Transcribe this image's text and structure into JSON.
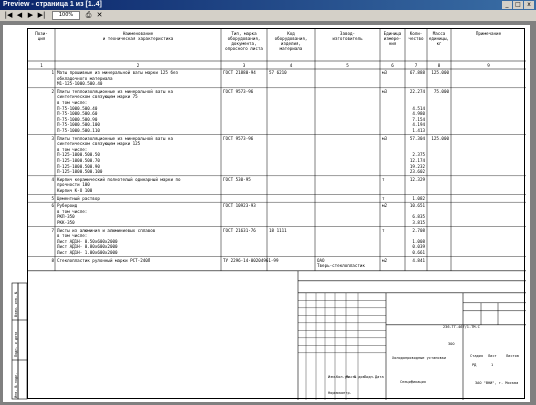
{
  "window": {
    "title": "Preview - страница 1 из [1..4]",
    "controls": [
      "_",
      "□",
      "x"
    ]
  },
  "toolbar": {
    "buttons": [
      "|◀",
      "◀",
      "▶",
      "▶|",
      "⎙",
      "✕"
    ],
    "page_select": "100%"
  },
  "spec": {
    "headers": [
      "Пози-\nция",
      "Наименование\nи техническая характеристика",
      "Тип, марка\nоборудования,\nдокумента,\nопросного листа",
      "Код\nоборудования,\nизделия,\nматериала",
      "Завод-\nизготовитель",
      "Единица\nизмере-\nния",
      "Коли-\nчество",
      "Масса\nединицы,\nкг",
      "Примечание"
    ],
    "col_numbers": [
      "1",
      "2",
      "3",
      "4",
      "5",
      "6",
      "7",
      "8",
      "9"
    ],
    "rows": [
      {
        "pos": "1",
        "name": [
          "Маты прошивные из минеральной ваты марки 125 без",
          "обкладочного материала",
          "М1-125-1000.500.40"
        ],
        "doc": "ГОСТ 21880-94",
        "code": "57 6210",
        "maker": "",
        "unit": "м3",
        "qty": [
          "67.888"
        ],
        "mass": "125.000",
        "note": ""
      },
      {
        "pos": "2",
        "name": [
          "Плиты теплоизоляционные из минеральной ваты на",
          "синтетическом связующем марки 75",
          "в том числе:",
          "П-75-1000.500.40",
          "П-75-1000.500.60",
          "П-75-1000.500.90",
          "П-75-1000.500.100",
          "П-75-1000.500.110"
        ],
        "doc": "ГОСТ 9573-96",
        "code": "",
        "maker": "",
        "unit": "м3",
        "qty": [
          "22.274",
          "",
          "",
          "4.514",
          "4.980",
          "7.154",
          "4.194",
          "1.413"
        ],
        "mass": "75.000",
        "note": ""
      },
      {
        "pos": "3",
        "name": [
          "Плиты теплоизоляционные из минеральной ваты на",
          "синтетическом связующем марки 125",
          "в том числе:",
          "П-125-1000.500.50",
          "П-125-1000.500.70",
          "П-125-1000.500.90",
          "П-125-1000.500.100"
        ],
        "doc": "ГОСТ 9573-96",
        "code": "",
        "maker": "",
        "unit": "м3",
        "qty": [
          "57.304",
          "",
          "",
          "2.375",
          "12.174",
          "19.232",
          "23.602"
        ],
        "mass": "125.000",
        "note": ""
      },
      {
        "pos": "4",
        "name": [
          "Кирпич керамический полнотелый одинарный марки по",
          "прочности 100",
          "Кирпич К-О 100"
        ],
        "doc": "ГОСТ 530-95",
        "code": "",
        "maker": "",
        "unit": "т",
        "qty": [
          "12.329"
        ],
        "mass": "",
        "note": ""
      },
      {
        "pos": "5",
        "name": [
          "Цементный раствор"
        ],
        "doc": "",
        "code": "",
        "maker": "",
        "unit": "т",
        "qty": [
          "1.082"
        ],
        "mass": "",
        "note": ""
      },
      {
        "pos": "6",
        "name": [
          "Рубероид",
          "в том числе:",
          "РКП-350",
          "РКК-350"
        ],
        "doc": "ГОСТ 10923-93",
        "code": "",
        "maker": "",
        "unit": "м2",
        "qty": [
          "10.651",
          "",
          "6.835",
          "3.815"
        ],
        "mass": "",
        "note": ""
      },
      {
        "pos": "7",
        "name": [
          "Листы из алюминия и алюминиевых сплавов",
          "в том числе:",
          "Лист АД1Н- 0.50x600x2000",
          "Лист АД1Н- 0.80x600x2000",
          "Лист АД1Н- 1.00x600x2000"
        ],
        "doc": "ГОСТ 21631-76",
        "code": "18 1111",
        "maker": "",
        "unit": "т",
        "qty": [
          "2.708",
          "",
          "1.008",
          "0.039",
          "0.661"
        ],
        "mass": "",
        "note": ""
      },
      {
        "pos": "8",
        "name": [
          "Стеклопластик рулонный марки РСТ-240Л"
        ],
        "doc": "ТУ 2296-14-00204961-99",
        "code": "",
        "maker": "ОАО\nТверь-стеклопластик",
        "unit": "м2",
        "qty": [
          "4.841"
        ],
        "mass": "",
        "note": ""
      }
    ]
  },
  "stamp": {
    "doc_code": "236-ТГ-467/1-ТМ.С",
    "object_title": "ЗОО",
    "part_title": "Холодопроводные установки",
    "section_title": "Спецификация",
    "stage_label": "Стадия",
    "sheet_label": "Лист",
    "sheets_label": "Листов",
    "stage": "РД",
    "sheet": "1",
    "org": "ЗАО \"ВНИ\", г. Москва",
    "change_headers": [
      "Изм.",
      "Кол.уч.",
      "Лист",
      "№ док.",
      "Подп.",
      "Дата"
    ],
    "role_checked": "Нормоконтр.",
    "side_labels": [
      "Взам. инв. №",
      "Подп. и дата",
      "Инв. № подл."
    ]
  }
}
